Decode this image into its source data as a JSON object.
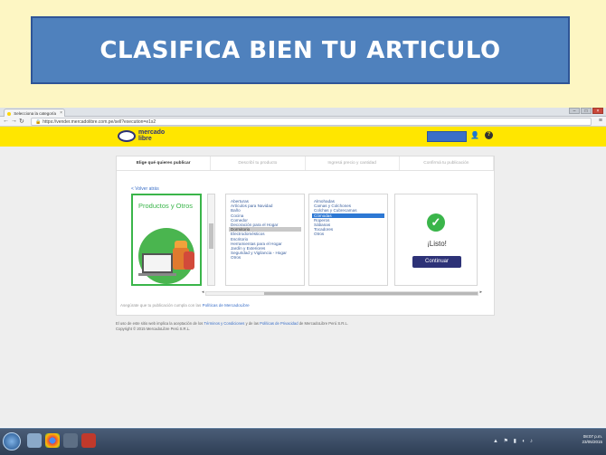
{
  "slide": {
    "title": "CLASIFICA BIEN TU ARTICULO",
    "colors": {
      "background": "#fdf6c3",
      "banner": "#4f81bd",
      "banner_text": "#ffffff"
    }
  },
  "browser": {
    "tab_title": "Selecciona la categoría",
    "url": "https://vender.mercadolibre.com.pe/sell?execution=e1s2"
  },
  "header": {
    "logo_line1": "mercado",
    "logo_line2": "libre",
    "colors": {
      "header": "#ffe600",
      "brand_blue": "#2d3277"
    }
  },
  "steps": [
    {
      "label": "Elige qué quieres publicar",
      "active": true
    },
    {
      "label": "Describí tu producto",
      "active": false
    },
    {
      "label": "Ingresá precio y cantidad",
      "active": false
    },
    {
      "label": "Confirmá tu publicación",
      "active": false
    }
  ],
  "back_link": "< Volver atrás",
  "category_card": {
    "label": "Productos y Otros"
  },
  "list1": [
    "Aberturas",
    "Artículos para Navidad",
    "Baño",
    "Cocina",
    "Comedor",
    "Decoración para el Hogar",
    "Dormitorio",
    "Electrodomésticos",
    "Escritorio",
    "Herramientas para el Hogar",
    "Jardín y Exteriores",
    "Seguridad y Vigilancia - Hogar",
    "Otros"
  ],
  "list1_selected": "Dormitorio",
  "list2": [
    "Almohadas",
    "Camas y Colchones",
    "Colchas y Cubrecamas",
    "Cómodas",
    "Roperos",
    "Sábanas",
    "Tocadores",
    "Otros"
  ],
  "list2_selected": "Cómodas",
  "done": {
    "text": "¡Listo!",
    "button": "Continuar"
  },
  "policy": {
    "prefix": "Asegúrate que tu publicación cumpla con las",
    "link": "Políticas de MercadoLibre"
  },
  "footer": {
    "line1_a": "El uso de este sitio web implica la aceptación de los",
    "line1_terms": "Términos y Condiciones",
    "line1_b": "y de las",
    "line1_privacy": "Políticas de Privacidad",
    "line1_c": "de MercadoLibre Perú S.R.L.",
    "line2": "Copyright © 2015 MercadoLibre Perú S.R.L."
  },
  "taskbar": {
    "time": "08:07 p.m.",
    "date": "23/05/2015",
    "icon_names": [
      "windows-start-icon",
      "explorer-icon",
      "chrome-icon",
      "media-icon",
      "pdf-icon",
      "folder-icon"
    ]
  }
}
